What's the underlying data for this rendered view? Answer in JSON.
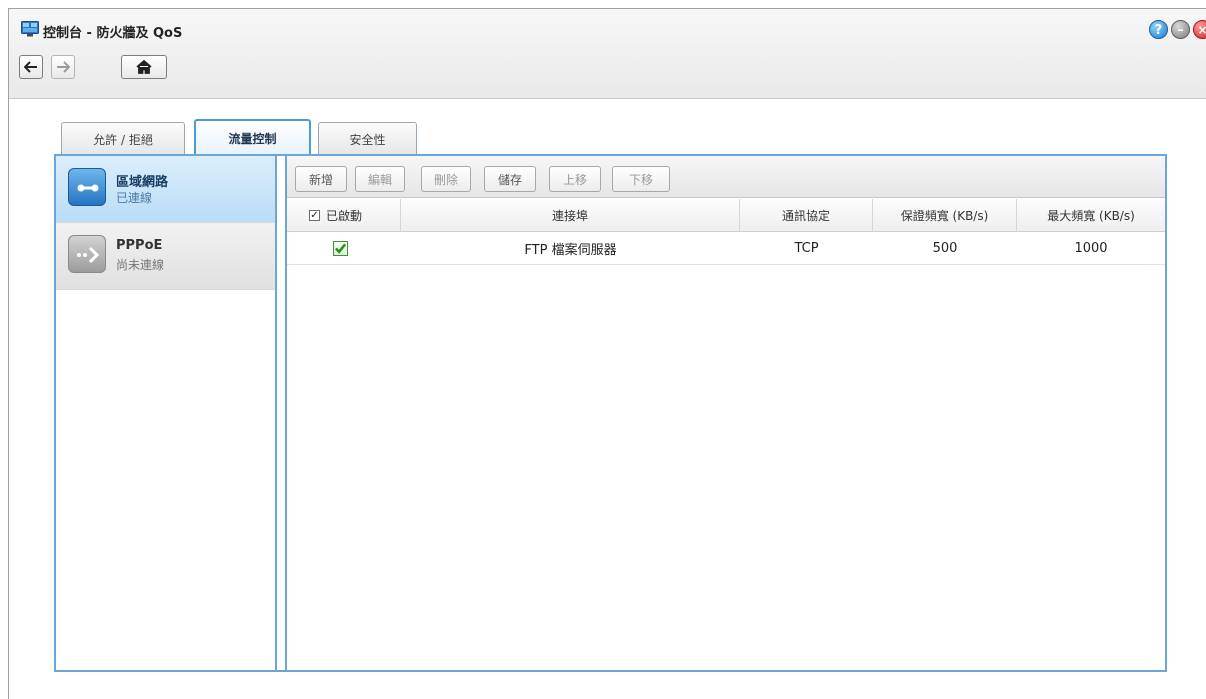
{
  "window": {
    "title": "控制台 - 防火牆及 QoS",
    "controls": {
      "help": "?",
      "minimize": "–",
      "close": "×"
    }
  },
  "nav": {
    "back_icon": "arrow-left-icon",
    "forward_icon": "arrow-right-icon",
    "home_icon": "home-icon"
  },
  "tabs": [
    {
      "label": "允許 / 拒絕",
      "active": false
    },
    {
      "label": "流量控制",
      "active": true
    },
    {
      "label": "安全性",
      "active": false
    }
  ],
  "sidebar": {
    "items": [
      {
        "title": "區域網路",
        "status": "已連線",
        "selected": true,
        "icon": "lan-icon"
      },
      {
        "title": "PPPoE",
        "status": "尚未連線",
        "selected": false,
        "icon": "pppoe-icon"
      }
    ]
  },
  "toolbar": {
    "add": "新增",
    "edit": "編輯",
    "delete": "刪除",
    "save": "儲存",
    "move_up": "上移",
    "move_down": "下移"
  },
  "table": {
    "headers": {
      "enabled": "已啟動",
      "port": "連接埠",
      "protocol": "通訊協定",
      "guaranteed": "保證頻寬 (KB/s)",
      "maximum": "最大頻寬 (KB/s)"
    },
    "rows": [
      {
        "enabled": true,
        "port": "FTP 檔案伺服器",
        "protocol": "TCP",
        "guaranteed": "500",
        "maximum": "1000"
      }
    ]
  },
  "colors": {
    "accent": "#4d9bd4",
    "selected_bg": "#cfe6fa",
    "close": "#d22424",
    "help": "#1f7fd0"
  }
}
